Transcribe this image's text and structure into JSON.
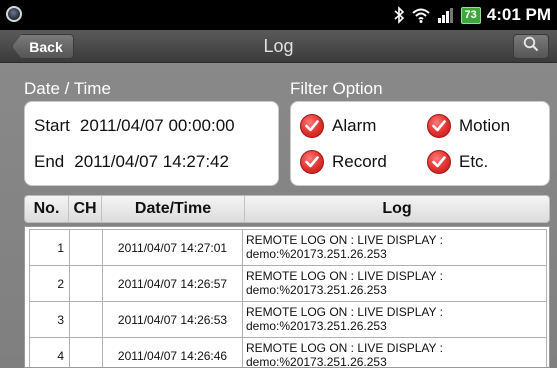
{
  "status_bar": {
    "battery_level": "73",
    "time": "4:01 PM",
    "icons": [
      "app-icon",
      "bluetooth-icon",
      "wifi-icon",
      "signal-icon",
      "battery-icon"
    ]
  },
  "titlebar": {
    "back_label": "Back",
    "title": "Log",
    "search_icon": "search-icon"
  },
  "date_time": {
    "section_label": "Date / Time",
    "start_label": "Start",
    "start_value": "2011/04/07 00:00:00",
    "end_label": "End",
    "end_value": "2011/04/07 14:27:42"
  },
  "filter": {
    "section_label": "Filter Option",
    "options": [
      {
        "label": "Alarm",
        "checked": true
      },
      {
        "label": "Motion",
        "checked": true
      },
      {
        "label": "Record",
        "checked": true
      },
      {
        "label": "Etc.",
        "checked": true
      }
    ],
    "check_color": "#e0302c"
  },
  "table": {
    "headers": [
      "No.",
      "CH",
      "Date/Time",
      "Log"
    ],
    "rows": [
      {
        "no": "1",
        "ch": "",
        "datetime": "2011/04/07 14:27:01",
        "log_line1": "REMOTE LOG ON : LIVE DISPLAY :",
        "log_line2": "demo:%20173.251.26.253"
      },
      {
        "no": "2",
        "ch": "",
        "datetime": "2011/04/07 14:26:57",
        "log_line1": "REMOTE LOG ON : LIVE DISPLAY :",
        "log_line2": "demo:%20173.251.26.253"
      },
      {
        "no": "3",
        "ch": "",
        "datetime": "2011/04/07 14:26:53",
        "log_line1": "REMOTE LOG ON : LIVE DISPLAY :",
        "log_line2": "demo:%20173.251.26.253"
      },
      {
        "no": "4",
        "ch": "",
        "datetime": "2011/04/07 14:26:46",
        "log_line1": "REMOTE LOG ON : LIVE DISPLAY :",
        "log_line2": "demo:%20173.251.26.253"
      }
    ]
  }
}
